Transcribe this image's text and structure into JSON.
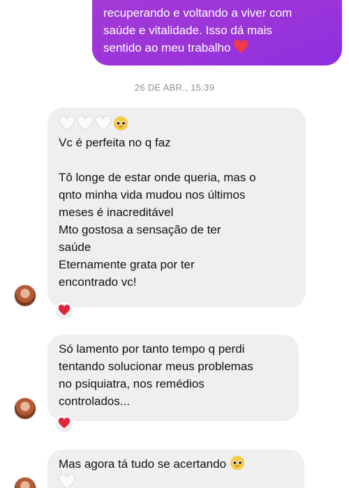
{
  "sent_message": {
    "line1": "recuperando e voltando a viver com",
    "line2": "saúde e vitalidade. Isso dá mais",
    "line3": "sentido ao meu trabalho"
  },
  "timestamp": "26 DE ABR., 15:39",
  "messages": [
    {
      "lines": [
        "Vc é perfeita no q faz",
        "",
        "Tô longe de estar onde queria, mas o",
        "qnto minha vida mudou nos últimos",
        "meses é inacreditável",
        "Mto gostosa a sensação de ter",
        "saúde",
        "Eternamente grata por ter",
        "encontrado vc!"
      ],
      "reaction": "red-heart"
    },
    {
      "lines": [
        "Só lamento por tanto tempo q perdi",
        "tentando solucionar meus problemas",
        "no psiquiatra, nos remédios",
        "controlados..."
      ],
      "reaction": "red-heart"
    },
    {
      "lines": [
        "Mas agora tá tudo se acertando"
      ]
    }
  ],
  "colors": {
    "sent_bubble": "#9b35d8",
    "received_bubble": "#efeff1",
    "timestamp": "#8e8e93",
    "reaction_heart": "#e0243c"
  },
  "icons": [
    "white-heart-icon",
    "pleading-face-icon",
    "red-heart-icon",
    "avatar"
  ]
}
